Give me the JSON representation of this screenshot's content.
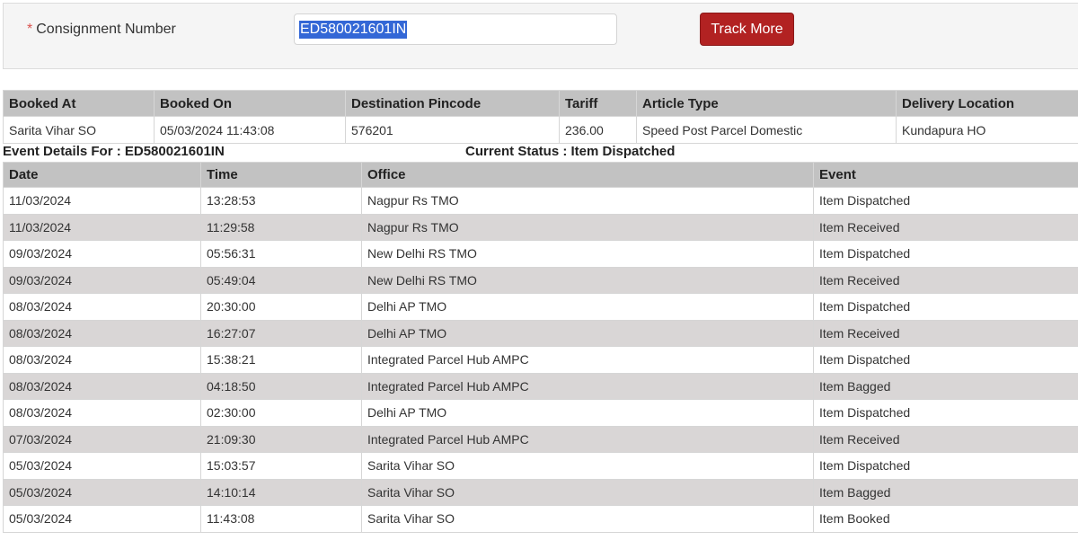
{
  "search": {
    "required_mark": "*",
    "label": "Consignment Number",
    "value": "ED580021601IN",
    "button_label": "Track More"
  },
  "booking": {
    "headers": [
      "Booked At",
      "Booked On",
      "Destination Pincode",
      "Tariff",
      "Article Type",
      "Delivery Location"
    ],
    "values": [
      "Sarita Vihar SO",
      "05/03/2024 11:43:08",
      "576201",
      "236.00",
      "Speed Post Parcel Domestic",
      "Kundapura HO"
    ]
  },
  "event_details": {
    "title_prefix": "Event Details For : ",
    "consignment": "ED580021601IN",
    "status_prefix": "Current Status : ",
    "status": "Item Dispatched"
  },
  "events": {
    "headers": [
      "Date",
      "Time",
      "Office",
      "Event"
    ],
    "rows": [
      [
        "11/03/2024",
        "13:28:53",
        "Nagpur Rs TMO",
        "Item Dispatched"
      ],
      [
        "11/03/2024",
        "11:29:58",
        "Nagpur Rs TMO",
        "Item Received"
      ],
      [
        "09/03/2024",
        "05:56:31",
        "New Delhi RS TMO",
        "Item Dispatched"
      ],
      [
        "09/03/2024",
        "05:49:04",
        "New Delhi RS TMO",
        "Item Received"
      ],
      [
        "08/03/2024",
        "20:30:00",
        "Delhi AP TMO",
        "Item Dispatched"
      ],
      [
        "08/03/2024",
        "16:27:07",
        "Delhi AP TMO",
        "Item Received"
      ],
      [
        "08/03/2024",
        "15:38:21",
        "Integrated Parcel Hub AMPC",
        "Item Dispatched"
      ],
      [
        "08/03/2024",
        "04:18:50",
        "Integrated Parcel Hub AMPC",
        "Item Bagged"
      ],
      [
        "08/03/2024",
        "02:30:00",
        "Delhi AP TMO",
        "Item Dispatched"
      ],
      [
        "07/03/2024",
        "21:09:30",
        "Integrated Parcel Hub AMPC",
        "Item Received"
      ],
      [
        "05/03/2024",
        "15:03:57",
        "Sarita Vihar SO",
        "Item Dispatched"
      ],
      [
        "05/03/2024",
        "14:10:14",
        "Sarita Vihar SO",
        "Item Bagged"
      ],
      [
        "05/03/2024",
        "11:43:08",
        "Sarita Vihar SO",
        "Item Booked"
      ]
    ]
  },
  "colors": {
    "button": "#b22222",
    "header_bg": "#c2c2c2",
    "row_alt": "#d9d6d6",
    "selection": "#3367d6",
    "required": "#d9534f"
  }
}
